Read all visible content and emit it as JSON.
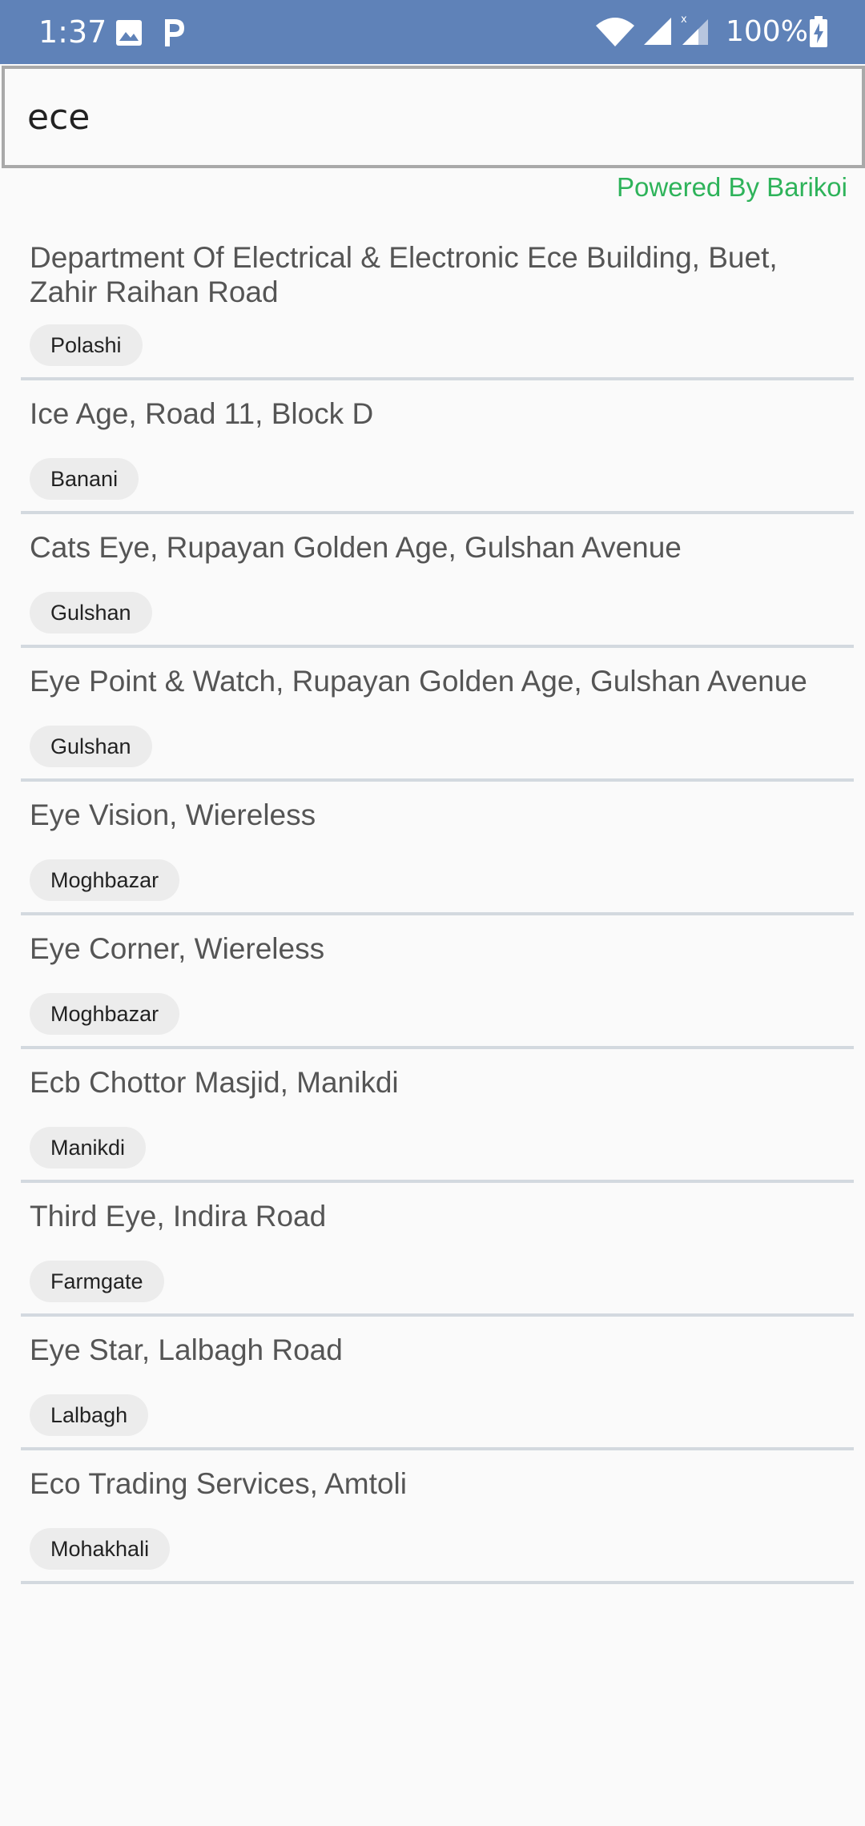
{
  "status_bar": {
    "time": "1:37",
    "battery": "100%",
    "icons": [
      "image-icon",
      "parking-app-icon",
      "wifi-icon",
      "cell-signal-icon",
      "cell-signal-x-icon",
      "battery-charging-icon"
    ]
  },
  "search": {
    "value": "ece",
    "placeholder": ""
  },
  "powered_by": {
    "text": "Powered By Barikoi",
    "color": "#2eb35a"
  },
  "results": [
    {
      "title": "Department Of Electrical & Electronic Ece Building, Buet, Zahir Raihan Road",
      "area": "Polashi"
    },
    {
      "title": "Ice Age, Road 11, Block D",
      "area": "Banani"
    },
    {
      "title": "Cats Eye, Rupayan Golden Age, Gulshan Avenue",
      "area": "Gulshan"
    },
    {
      "title": "Eye Point & Watch, Rupayan Golden Age, Gulshan Avenue",
      "area": "Gulshan"
    },
    {
      "title": "Eye Vision, Wiereless",
      "area": "Moghbazar"
    },
    {
      "title": "Eye Corner, Wiereless",
      "area": "Moghbazar"
    },
    {
      "title": "Ecb Chottor Masjid, Manikdi",
      "area": "Manikdi"
    },
    {
      "title": "Third Eye, Indira Road",
      "area": "Farmgate"
    },
    {
      "title": "Eye Star, Lalbagh Road",
      "area": "Lalbagh"
    },
    {
      "title": "Eco Trading Services, Amtoli",
      "area": "Mohakhali"
    }
  ],
  "colors": {
    "status_bar": "#5f82b8",
    "background": "#fafafa",
    "divider": "#d3d9df",
    "chip": "#ececec"
  }
}
